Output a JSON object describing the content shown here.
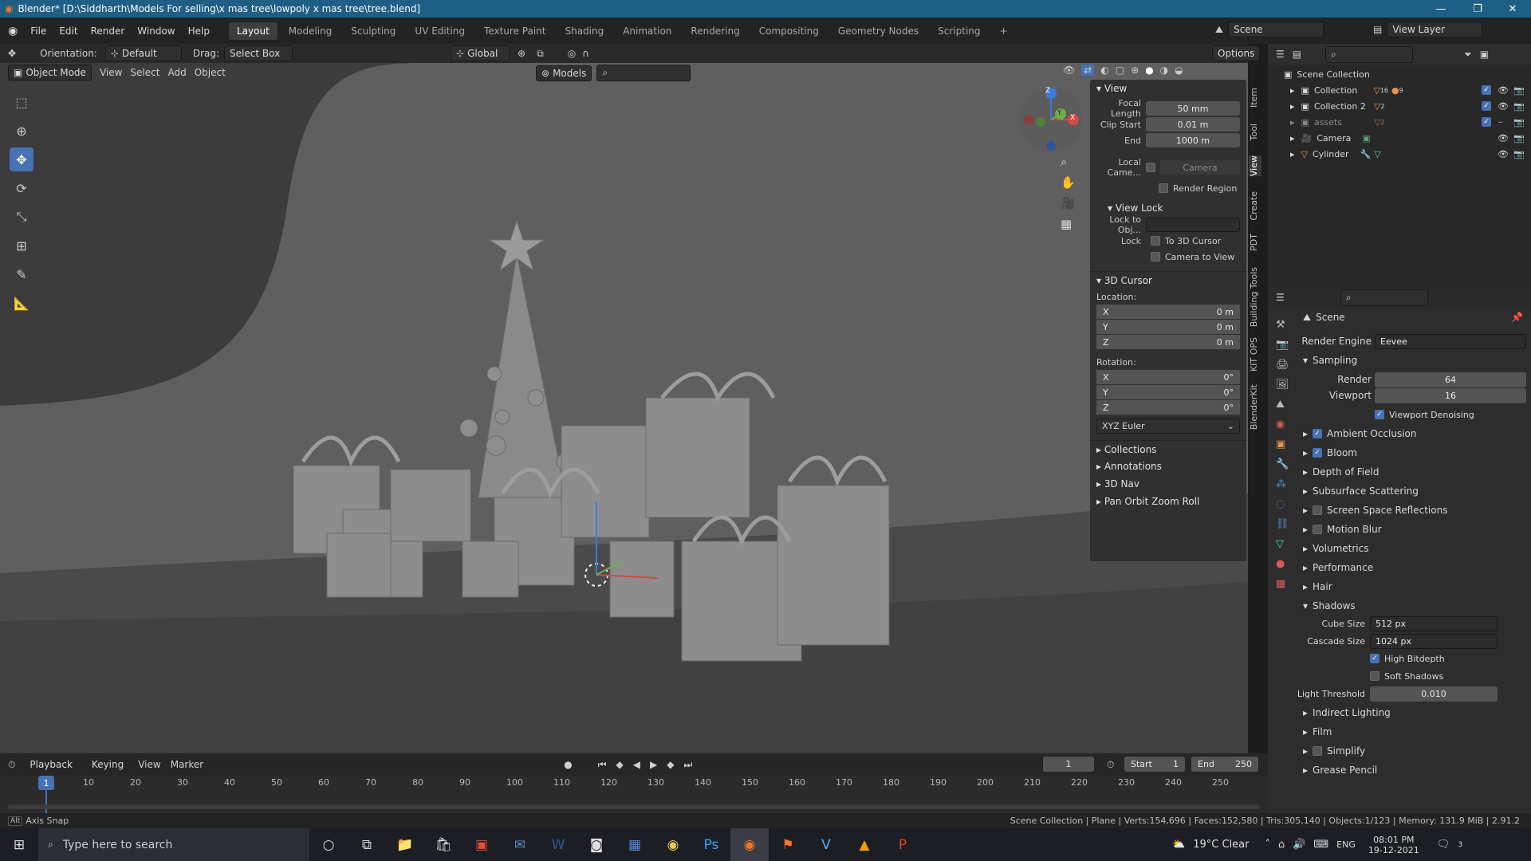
{
  "titlebar": {
    "title": "Blender* [D:\\Siddharth\\Models For selling\\x mas tree\\lowpoly x mas tree\\tree.blend]",
    "minimize": "—",
    "maximize": "❐",
    "close": "✕"
  },
  "menu": [
    "File",
    "Edit",
    "Render",
    "Window",
    "Help"
  ],
  "workspaces": [
    "Layout",
    "Modeling",
    "Sculpting",
    "UV Editing",
    "Texture Paint",
    "Shading",
    "Animation",
    "Rendering",
    "Compositing",
    "Geometry Nodes",
    "Scripting"
  ],
  "workspace_active": "Layout",
  "add_workspace": "+",
  "scene": {
    "name": "Scene",
    "view_layer": "View Layer"
  },
  "toolhdr": {
    "orientation_label": "Orientation:",
    "orientation_value": "Default",
    "drag_label": "Drag:",
    "drag_value": "Select Box",
    "transform_orientation": "Global",
    "options": "Options"
  },
  "viewport_header": {
    "mode": "Object Mode",
    "menus": [
      "View",
      "Select",
      "Add",
      "Object"
    ],
    "collection_filter": "Models"
  },
  "gizmo": {
    "z": "Z",
    "y": "Y",
    "x": "X"
  },
  "npanel": {
    "view_title": "View",
    "focal_length_label": "Focal Length",
    "focal_length": "50 mm",
    "clip_start_label": "Clip Start",
    "clip_start": "0.01 m",
    "clip_end_label": "End",
    "clip_end": "1000 m",
    "local_camera_label": "Local Came...",
    "local_camera_value": "Camera",
    "render_region": "Render Region",
    "view_lock_title": "View Lock",
    "lock_to_obj_label": "Lock to Obj...",
    "lock_label": "Lock",
    "lock_cursor": "To 3D Cursor",
    "camera_to_view": "Camera to View",
    "cursor_title": "3D Cursor",
    "location_label": "Location:",
    "loc": [
      {
        "axis": "X",
        "val": "0 m"
      },
      {
        "axis": "Y",
        "val": "0 m"
      },
      {
        "axis": "Z",
        "val": "0 m"
      }
    ],
    "rotation_label": "Rotation:",
    "rot": [
      {
        "axis": "X",
        "val": "0°"
      },
      {
        "axis": "Y",
        "val": "0°"
      },
      {
        "axis": "Z",
        "val": "0°"
      }
    ],
    "rotation_mode": "XYZ Euler",
    "collapsed": [
      "Collections",
      "Annotations",
      "3D Nav",
      "Pan Orbit Zoom Roll"
    ]
  },
  "side_tabs": [
    "Item",
    "Tool",
    "View",
    "Create",
    "PDT",
    "Building Tools",
    "KIT OPS",
    "BlenderKit"
  ],
  "outliner": {
    "root": "Scene Collection",
    "items": [
      {
        "name": "Collection",
        "badge": "16",
        "badge2": "9",
        "visible": true
      },
      {
        "name": "Collection 2",
        "badge": "2",
        "visible": true
      },
      {
        "name": "assets",
        "badge": "2",
        "visible": false
      },
      {
        "name": "Camera",
        "visible": true
      },
      {
        "name": "Cylinder",
        "visible": true
      }
    ]
  },
  "properties": {
    "context": "Scene",
    "render_engine_label": "Render Engine",
    "render_engine": "Eevee",
    "sampling": "Sampling",
    "render_label": "Render",
    "render_samples": "64",
    "viewport_label": "Viewport",
    "viewport_samples": "16",
    "viewport_denoising": "Viewport Denoising",
    "panels": [
      {
        "name": "Ambient Occlusion",
        "check": true
      },
      {
        "name": "Bloom",
        "check": true
      },
      {
        "name": "Depth of Field"
      },
      {
        "name": "Subsurface Scattering"
      },
      {
        "name": "Screen Space Reflections",
        "check": false
      },
      {
        "name": "Motion Blur",
        "check": false
      },
      {
        "name": "Volumetrics"
      },
      {
        "name": "Performance"
      },
      {
        "name": "Hair"
      }
    ],
    "shadows": "Shadows",
    "cube_size_label": "Cube Size",
    "cube_size": "512 px",
    "cascade_size_label": "Cascade Size",
    "cascade_size": "1024 px",
    "high_bitdepth": "High Bitdepth",
    "soft_shadows": "Soft Shadows",
    "light_threshold_label": "Light Threshold",
    "light_threshold": "0.010",
    "after": [
      {
        "name": "Indirect Lighting"
      },
      {
        "name": "Film"
      },
      {
        "name": "Simplify",
        "check": false
      },
      {
        "name": "Grease Pencil"
      }
    ]
  },
  "timeline": {
    "menus": [
      "Playback",
      "Keying",
      "View",
      "Marker"
    ],
    "current_frame": "1",
    "start_label": "Start",
    "start": "1",
    "end_label": "End",
    "end": "250",
    "ticks": [
      "10",
      "20",
      "30",
      "40",
      "50",
      "60",
      "70",
      "80",
      "90",
      "100",
      "110",
      "120",
      "130",
      "140",
      "150",
      "160",
      "170",
      "180",
      "190",
      "200",
      "210",
      "220",
      "230",
      "240",
      "250"
    ],
    "playhead": "1"
  },
  "statusbar": {
    "hint_key": "Alt",
    "hint": "Axis Snap",
    "stats": "Scene Collection | Plane | Verts:154,696 | Faces:152,580 | Tris:305,140 | Objects:1/123 | Memory: 131.9 MiB | 2.91.2"
  },
  "taskbar": {
    "search_placeholder": "Type here to search",
    "weather": "19°C  Clear",
    "lang": "ENG",
    "time": "08:01 PM",
    "date": "19-12-2021",
    "notif_count": "3"
  }
}
